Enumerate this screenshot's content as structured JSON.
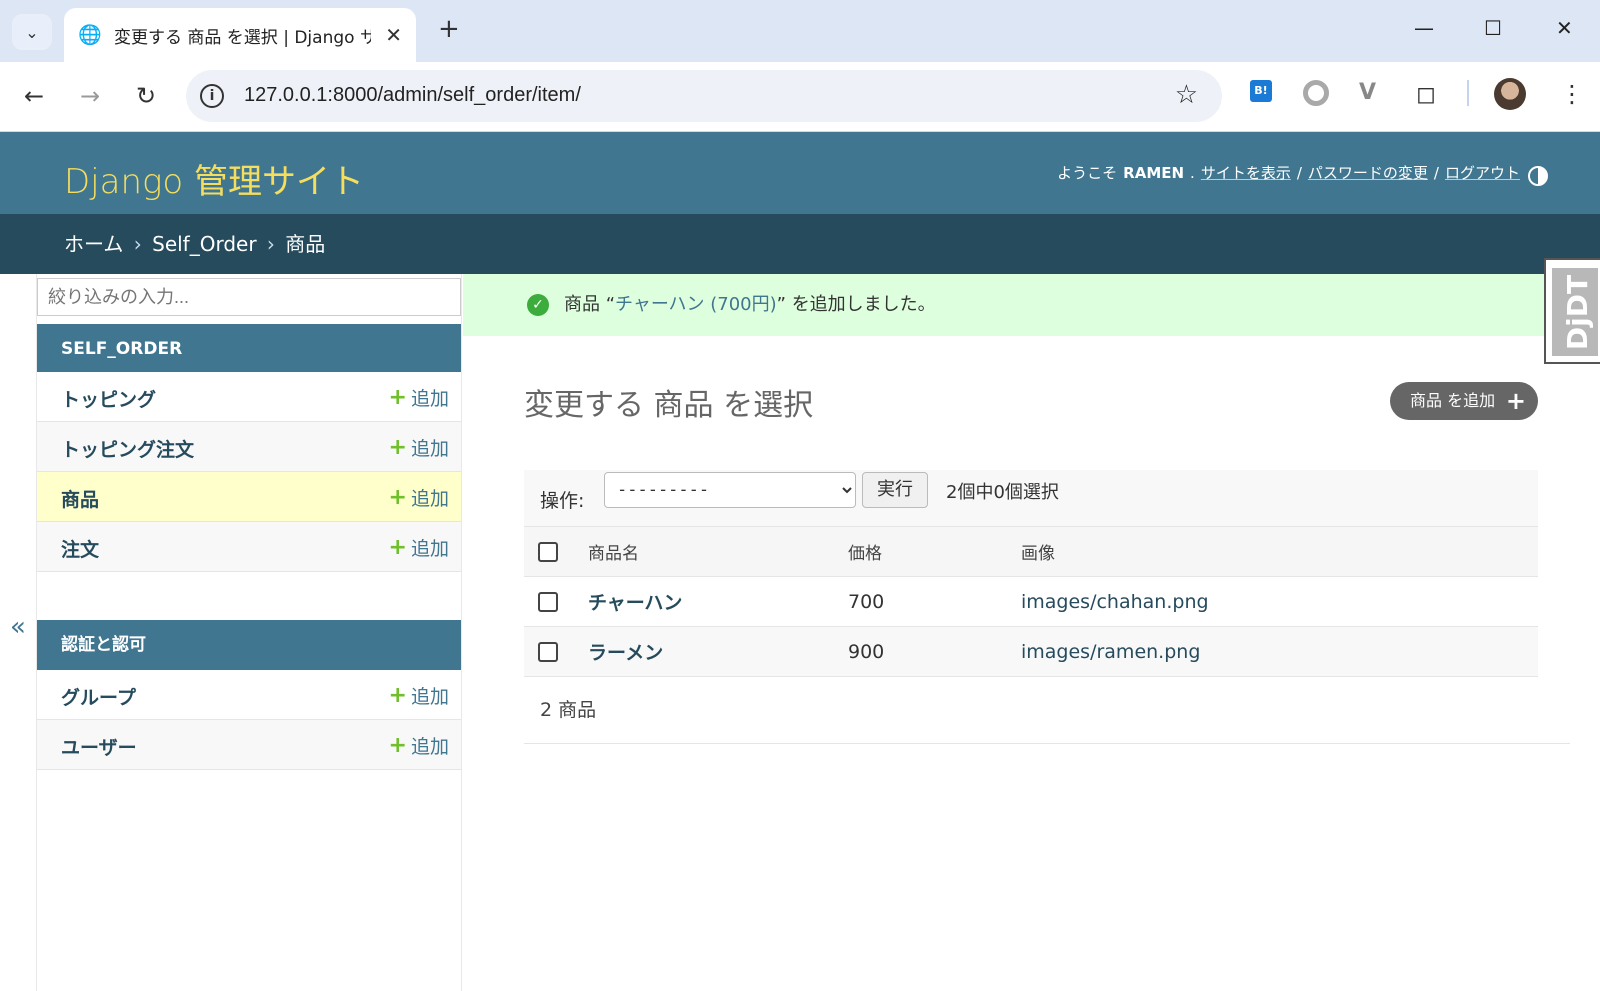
{
  "browser": {
    "tab_title": "変更する 商品 を選択 | Django サ",
    "url": "127.0.0.1:8000/admin/self_order/item/"
  },
  "admin": {
    "brand": "Django 管理サイト",
    "welcome": "ようこそ",
    "username": "RAMEN",
    "view_site": "サイトを表示",
    "change_password": "パスワードの変更",
    "logout": "ログアウト",
    "breadcrumbs": [
      "ホーム",
      "Self_Order",
      "商品"
    ]
  },
  "sidebar": {
    "filter_placeholder": "絞り込みの入力...",
    "modules": [
      {
        "caption": "SELF_ORDER",
        "models": [
          {
            "name": "トッピング",
            "add": "追加"
          },
          {
            "name": "トッピング注文",
            "add": "追加"
          },
          {
            "name": "商品",
            "add": "追加"
          },
          {
            "name": "注文",
            "add": "追加"
          }
        ]
      },
      {
        "caption": "認証と認可",
        "models": [
          {
            "name": "グループ",
            "add": "追加"
          },
          {
            "name": "ユーザー",
            "add": "追加"
          }
        ]
      }
    ],
    "collapse": "«"
  },
  "message": {
    "prefix": "商品 “",
    "link": "チャーハン (700円)",
    "suffix": "” を追加しました。"
  },
  "main": {
    "title": "変更する 商品 を選択",
    "add_button": "商品 を追加",
    "action_label": "操作:",
    "action_selected": "---------",
    "run_button": "実行",
    "counter": "2個中0個選択",
    "columns": [
      "商品名",
      "価格",
      "画像"
    ],
    "rows": [
      {
        "name": "チャーハン",
        "price": "700",
        "image": "images/chahan.png"
      },
      {
        "name": "ラーメン",
        "price": "900",
        "image": "images/ramen.png"
      }
    ],
    "paginator": "2 商品"
  },
  "djdt_label": "DjDT"
}
